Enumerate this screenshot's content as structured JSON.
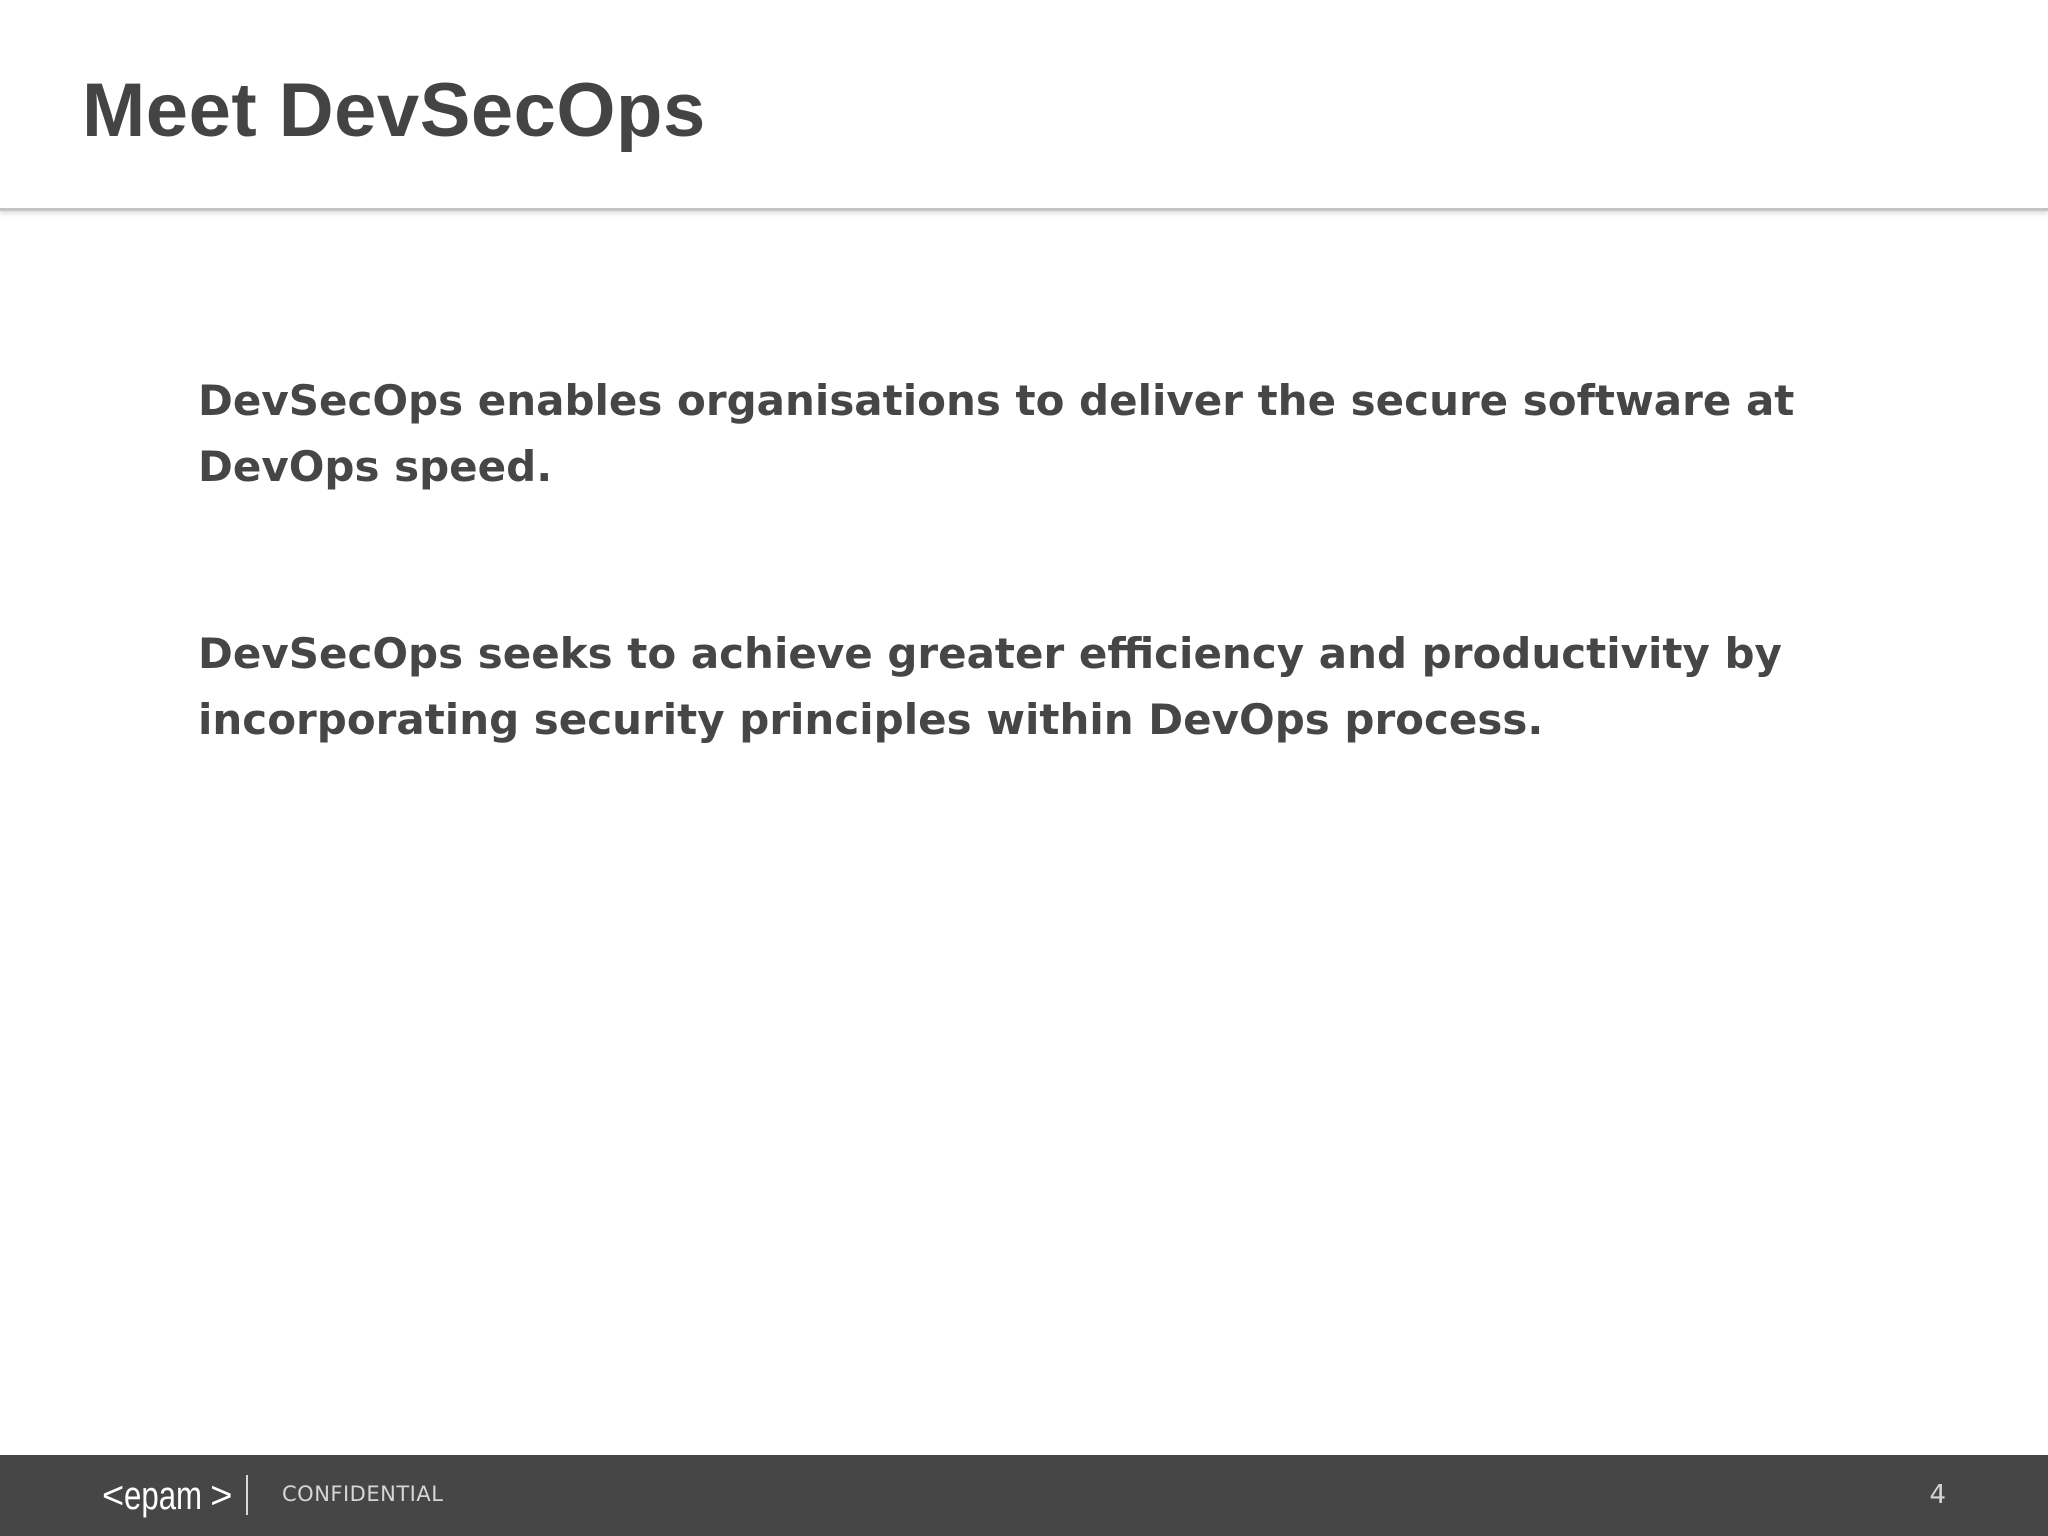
{
  "slide": {
    "title": "Meet DevSecOps",
    "paragraphs": [
      "DevSecOps enables organisations to deliver the secure software at DevOps speed.",
      "DevSecOps seeks to achieve greater efficiency and productivity by incorporating security principles within DevOps process."
    ]
  },
  "footer": {
    "logo_text": "epam",
    "logo_open": "<",
    "logo_close": ">",
    "confidential": "CONFIDENTIAL",
    "page_number": "4"
  },
  "colors": {
    "text": "#464646",
    "footer_bg": "#464646",
    "footer_text": "#d6d6d6"
  }
}
